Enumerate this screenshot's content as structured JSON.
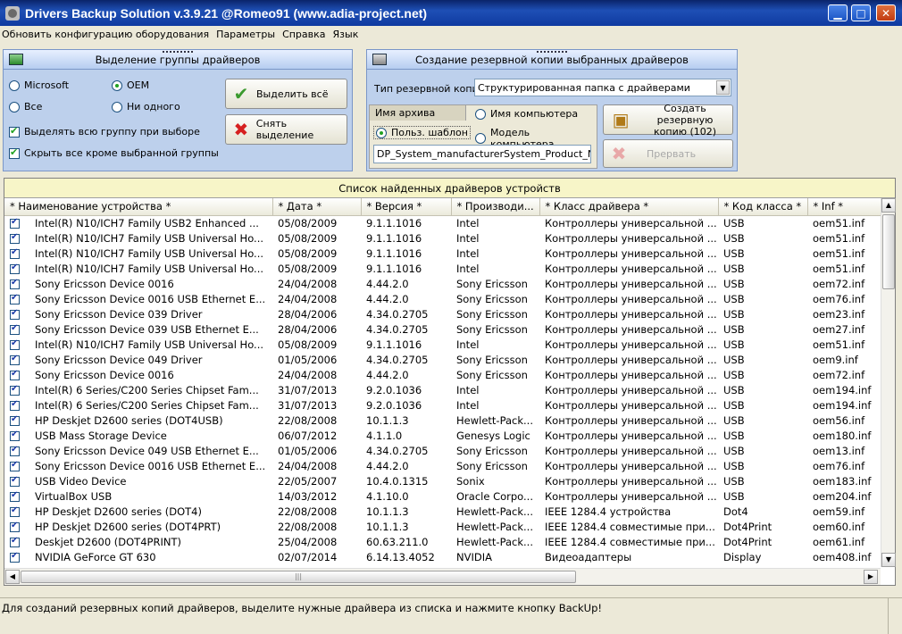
{
  "window": {
    "title": "Drivers Backup Solution v.3.9.21 @Romeo91 (www.adia-project.net)",
    "minimize": "▁",
    "maximize": "□",
    "close": "✕"
  },
  "menu": [
    "Обновить конфигурацию оборудования",
    "Параметры",
    "Справка",
    "Язык"
  ],
  "left_panel": {
    "title": "Выделение группы драйверов",
    "radios": [
      {
        "label": "Microsoft",
        "checked": false
      },
      {
        "label": "OEM",
        "checked": true
      },
      {
        "label": "Все",
        "checked": false
      },
      {
        "label": "Ни одного",
        "checked": false
      }
    ],
    "checkbox_group": {
      "label": "Выделять всю группу при выборе",
      "checked": true
    },
    "checkbox_hide": {
      "label": "Скрыть все кроме выбранной группы",
      "checked": true
    },
    "select_all": "Выделить всё",
    "deselect": "Снять выделение"
  },
  "right_panel": {
    "title": "Создание резервной копии выбранных драйверов",
    "backup_type_label": "Тип резервной копии",
    "backup_type_value": "Структурированная папка с драйверами",
    "archive_name_label": "Имя архива",
    "radio_computer_name": "Имя компьютера",
    "radio_user_template": "Польз. шаблон",
    "radio_computer_model": "Модель компьютера",
    "template_value": "DP_System_manufacturerSystem_Product_Name",
    "create_backup_line1": "Создать резервную",
    "create_backup_line2": "копию (102)",
    "abort": "Прервать"
  },
  "grid": {
    "caption": "Список найденных драйверов устройств",
    "columns": [
      "* Наименование устройства *",
      "* Дата *",
      "* Версия *",
      "* Производи...",
      "* Класс драйвера *",
      "* Код класса *",
      "* Inf *"
    ],
    "rows": [
      [
        "Intel(R) N10/ICH7 Family USB2 Enhanced ...",
        "05/08/2009",
        "9.1.1.1016",
        "Intel",
        "Контроллеры универсальной ...",
        "USB",
        "oem51.inf"
      ],
      [
        "Intel(R) N10/ICH7 Family USB Universal Ho...",
        "05/08/2009",
        "9.1.1.1016",
        "Intel",
        "Контроллеры универсальной ...",
        "USB",
        "oem51.inf"
      ],
      [
        "Intel(R) N10/ICH7 Family USB Universal Ho...",
        "05/08/2009",
        "9.1.1.1016",
        "Intel",
        "Контроллеры универсальной ...",
        "USB",
        "oem51.inf"
      ],
      [
        "Intel(R) N10/ICH7 Family USB Universal Ho...",
        "05/08/2009",
        "9.1.1.1016",
        "Intel",
        "Контроллеры универсальной ...",
        "USB",
        "oem51.inf"
      ],
      [
        "Sony Ericsson Device 0016",
        "24/04/2008",
        "4.44.2.0",
        "Sony Ericsson",
        "Контроллеры универсальной ...",
        "USB",
        "oem72.inf"
      ],
      [
        "Sony Ericsson Device 0016 USB Ethernet E...",
        "24/04/2008",
        "4.44.2.0",
        "Sony Ericsson",
        "Контроллеры универсальной ...",
        "USB",
        "oem76.inf"
      ],
      [
        "Sony Ericsson Device 039 Driver",
        "28/04/2006",
        "4.34.0.2705",
        "Sony Ericsson",
        "Контроллеры универсальной ...",
        "USB",
        "oem23.inf"
      ],
      [
        "Sony Ericsson Device 039 USB Ethernet E...",
        "28/04/2006",
        "4.34.0.2705",
        "Sony Ericsson",
        "Контроллеры универсальной ...",
        "USB",
        "oem27.inf"
      ],
      [
        "Intel(R) N10/ICH7 Family USB Universal Ho...",
        "05/08/2009",
        "9.1.1.1016",
        "Intel",
        "Контроллеры универсальной ...",
        "USB",
        "oem51.inf"
      ],
      [
        "Sony Ericsson Device 049 Driver",
        "01/05/2006",
        "4.34.0.2705",
        "Sony Ericsson",
        "Контроллеры универсальной ...",
        "USB",
        "oem9.inf"
      ],
      [
        "Sony Ericsson Device 0016",
        "24/04/2008",
        "4.44.2.0",
        "Sony Ericsson",
        "Контроллеры универсальной ...",
        "USB",
        "oem72.inf"
      ],
      [
        "Intel(R) 6 Series/C200 Series Chipset Fam...",
        "31/07/2013",
        "9.2.0.1036",
        "Intel",
        "Контроллеры универсальной ...",
        "USB",
        "oem194.inf"
      ],
      [
        "Intel(R) 6 Series/C200 Series Chipset Fam...",
        "31/07/2013",
        "9.2.0.1036",
        "Intel",
        "Контроллеры универсальной ...",
        "USB",
        "oem194.inf"
      ],
      [
        "HP Deskjet D2600 series (DOT4USB)",
        "22/08/2008",
        "10.1.1.3",
        "Hewlett-Pack...",
        "Контроллеры универсальной ...",
        "USB",
        "oem56.inf"
      ],
      [
        "USB Mass Storage Device",
        "06/07/2012",
        "4.1.1.0",
        "Genesys Logic",
        "Контроллеры универсальной ...",
        "USB",
        "oem180.inf"
      ],
      [
        "Sony Ericsson Device 049 USB Ethernet E...",
        "01/05/2006",
        "4.34.0.2705",
        "Sony Ericsson",
        "Контроллеры универсальной ...",
        "USB",
        "oem13.inf"
      ],
      [
        "Sony Ericsson Device 0016 USB Ethernet E...",
        "24/04/2008",
        "4.44.2.0",
        "Sony Ericsson",
        "Контроллеры универсальной ...",
        "USB",
        "oem76.inf"
      ],
      [
        "USB Video Device",
        "22/05/2007",
        "10.4.0.1315",
        "Sonix",
        "Контроллеры универсальной ...",
        "USB",
        "oem183.inf"
      ],
      [
        "VirtualBox USB",
        "14/03/2012",
        "4.1.10.0",
        "Oracle Corpo...",
        "Контроллеры универсальной ...",
        "USB",
        "oem204.inf"
      ],
      [
        "HP Deskjet D2600 series (DOT4)",
        "22/08/2008",
        "10.1.1.3",
        "Hewlett-Pack...",
        "IEEE 1284.4 устройства",
        "Dot4",
        "oem59.inf"
      ],
      [
        "HP Deskjet D2600 series (DOT4PRT)",
        "22/08/2008",
        "10.1.1.3",
        "Hewlett-Pack...",
        "IEEE 1284.4 совместимые при...",
        "Dot4Print",
        "oem60.inf"
      ],
      [
        "Deskjet D2600 (DOT4PRINT)",
        "25/04/2008",
        "60.63.211.0",
        "Hewlett-Pack...",
        "IEEE 1284.4 совместимые при...",
        "Dot4Print",
        "oem61.inf"
      ],
      [
        "NVIDIA GeForce GT 630",
        "02/07/2014",
        "6.14.13.4052",
        "NVIDIA",
        "Видеоадаптеры",
        "Display",
        "oem408.inf"
      ]
    ]
  },
  "status": "Для созданий резервных копий драйверов, выделите нужные драйвера из списка и нажмите кнопку BackUp!",
  "colors": {
    "title_bar": "#0f3aa0",
    "panel_bg": "#bdd0ec",
    "caption_bg": "#f7f5c8"
  }
}
